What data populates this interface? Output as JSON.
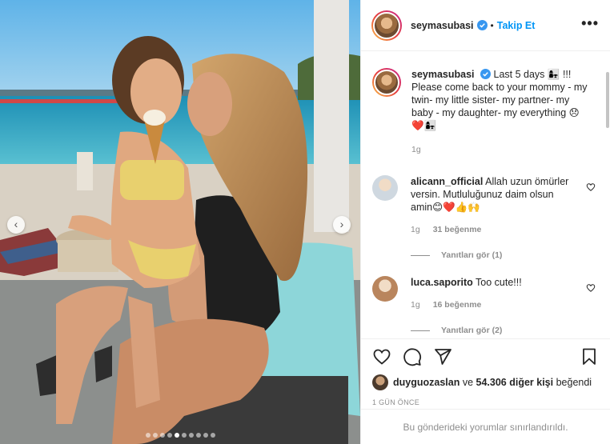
{
  "post": {
    "username": "seymasubasi",
    "follow_label": "Takip Et",
    "separator": "•",
    "more_label": "•••",
    "nav_prev": "‹",
    "nav_next": "›",
    "carousel": {
      "count": 10,
      "active": 4
    }
  },
  "caption": {
    "username": "seymasubasi",
    "text": "Last 5 days 👩‍👧 !!! Please come back to your mommy - my twin- my little sister- my partner- my baby - my daughter- my everything 😞❤️👩‍👧",
    "time": "1g"
  },
  "comments": [
    {
      "username": "alicann_official",
      "text": "Allah uzun ömürler versin. Mutluluğunuz daim olsun amin😊❤️👍🙌",
      "time": "1g",
      "likes": "31 beğenme",
      "replies": "Yanıtları gör (1)",
      "avatar_color": "#cfd8e0"
    },
    {
      "username": "luca.saporito",
      "text": "Too cute!!!",
      "time": "1g",
      "likes": "16 beğenme",
      "replies": "Yanıtları gör (2)",
      "avatar_color": "#b9855d"
    }
  ],
  "footer": {
    "liker": "duyguozaslan",
    "likes_text": "ve",
    "likes_count": "54.306 diğer kişi",
    "likes_suffix": "beğendi",
    "date": "1 GÜN ÖNCE",
    "comments_limited": "Bu gönderideki yorumlar sınırlandırıldı."
  },
  "icons": {
    "verified": "verified-badge-icon",
    "like": "heart-icon",
    "comment": "comment-icon",
    "share": "paper-plane-icon",
    "save": "bookmark-icon"
  },
  "colors": {
    "link": "#0095f6",
    "muted": "#8e8e8e",
    "text": "#262626",
    "heart_red": "#ed4956"
  }
}
